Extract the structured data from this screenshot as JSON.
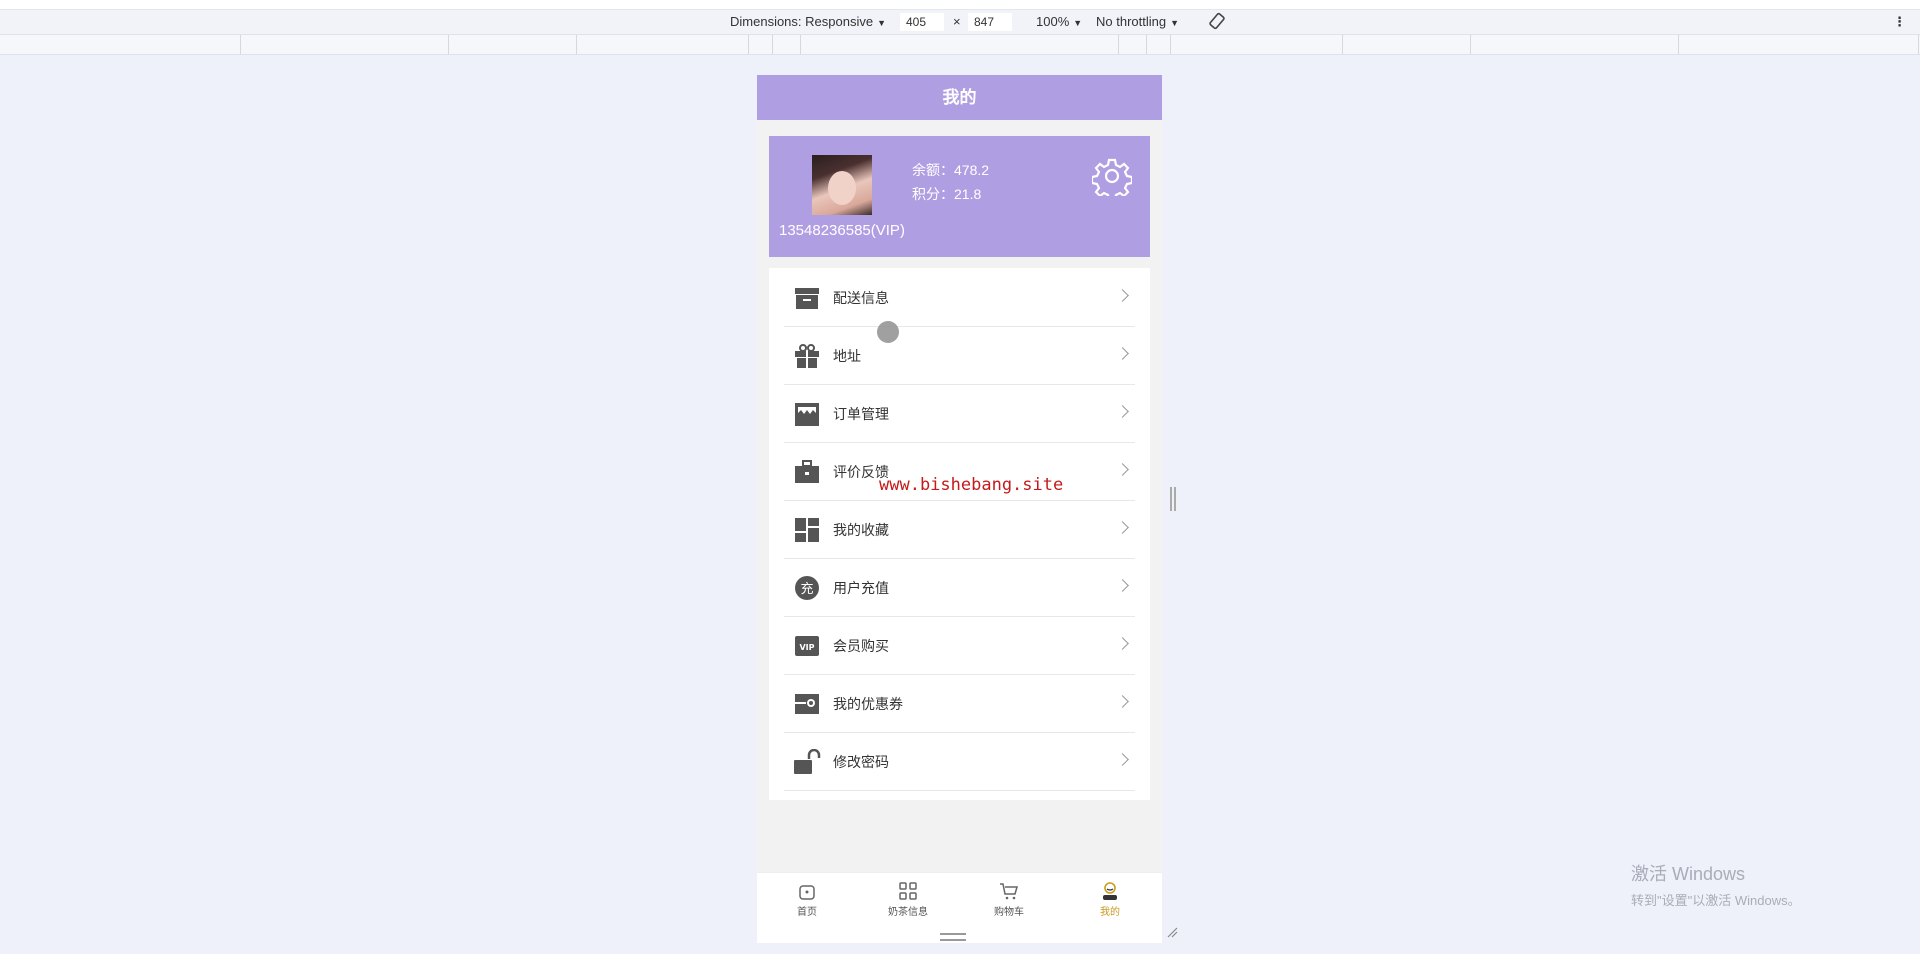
{
  "devtools": {
    "dimensions_label": "Dimensions: Responsive",
    "width": "405",
    "times": "×",
    "height": "847",
    "zoom": "100%",
    "throttling": "No throttling"
  },
  "app": {
    "title": "我的",
    "profile": {
      "balance_label": "余额：",
      "balance_value": "478.2",
      "points_label": "积分：",
      "points_value": "21.8",
      "phone": "13548236585(VIP)"
    },
    "menu": [
      {
        "label": "配送信息",
        "icon": "archive-icon"
      },
      {
        "label": "地址",
        "icon": "gift-icon"
      },
      {
        "label": "订单管理",
        "icon": "store-icon"
      },
      {
        "label": "评价反馈",
        "icon": "briefcase-icon"
      },
      {
        "label": "我的收藏",
        "icon": "dashboard-icon"
      },
      {
        "label": "用户充值",
        "icon": "recharge-icon",
        "glyph": "充"
      },
      {
        "label": "会员购买",
        "icon": "vip-icon",
        "glyph": "VIP"
      },
      {
        "label": "我的优惠券",
        "icon": "coupon-icon"
      },
      {
        "label": "修改密码",
        "icon": "unlock-icon"
      }
    ],
    "tabs": [
      {
        "label": "首页",
        "icon": "home-icon"
      },
      {
        "label": "奶茶信息",
        "icon": "grid-icon"
      },
      {
        "label": "购物车",
        "icon": "cart-icon"
      },
      {
        "label": "我的",
        "icon": "user-icon",
        "active": true
      }
    ]
  },
  "watermark": "www.bishebang.site",
  "windows_activation": {
    "line1": "激活 Windows",
    "line2": "转到\"设置\"以激活 Windows。"
  },
  "colors": {
    "accent": "#b09ee3",
    "active_tab": "#c99a20",
    "watermark": "#c41a1a"
  }
}
